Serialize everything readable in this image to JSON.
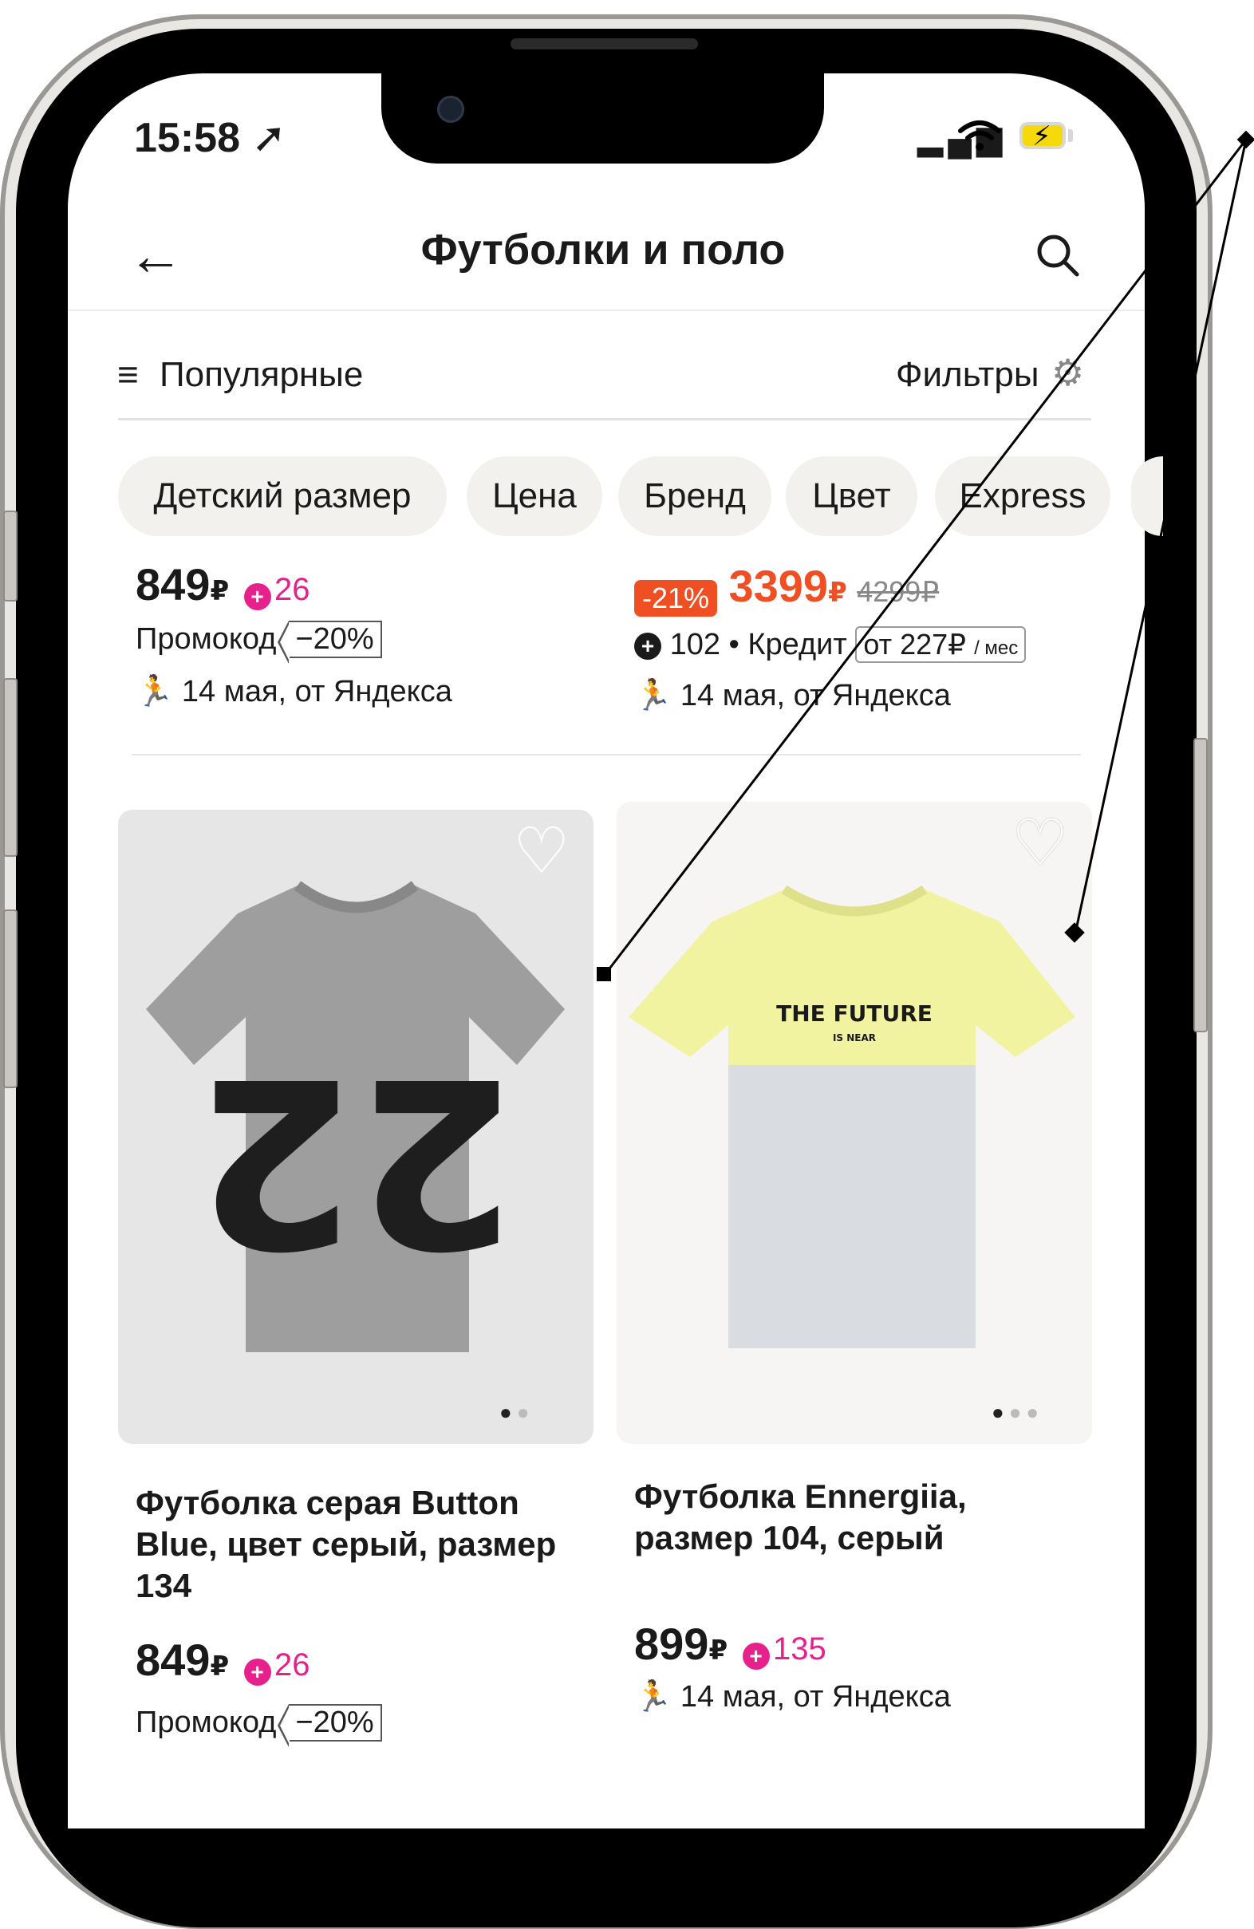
{
  "status_bar": {
    "time": "15:58 ➚",
    "signal": "▂▄▆",
    "wifi": "wifi-icon"
  },
  "header": {
    "back_icon": "←",
    "title": "Футболки и поло",
    "search_icon": "⚲"
  },
  "sort_bar": {
    "sort_icon": "≡",
    "sort_label": "Популярные",
    "filters_label": "Фильтры",
    "filters_icon": "⚙"
  },
  "chips": [
    "Детский размер",
    "Цена",
    "Бренд",
    "Цвет",
    "Express"
  ],
  "top_left": {
    "price": "849",
    "currency": "₽",
    "plus_points": "26",
    "promo_label": "Промокод",
    "promo_value": "−20%",
    "delivery": "14 мая, от Яндекса"
  },
  "top_right": {
    "discount": "-21%",
    "price": "3399",
    "currency": "₽",
    "old_price": "4299₽",
    "plus_points": "102",
    "credit_label": "Кредит",
    "credit_value": "от 227₽",
    "credit_unit": "/ мес",
    "delivery": "14 мая, от Яндекса"
  },
  "products": [
    {
      "title": "Футболка серая Button Blue, цвет серый, размер 134",
      "price": "849",
      "currency": "₽",
      "plus_points": "26",
      "promo_label": "Промокод",
      "promo_value": "−20%",
      "image_print": "22",
      "colors": {
        "bg": "#e6e6e6",
        "shirt": "#9e9e9e"
      }
    },
    {
      "title": "Футболка Ennergiia, размер 104, серый",
      "price": "899",
      "currency": "₽",
      "plus_points": "135",
      "delivery": "14 мая, от Яндекса",
      "image_print": "THE FUTURE",
      "image_print_sub": "IS NEAR",
      "colors": {
        "bg": "#f6f5f3",
        "top": "#f2f3a0",
        "bottom": "#d9dde1"
      }
    }
  ],
  "colors": {
    "plus": "#e7218c",
    "sale": "#f04f23"
  }
}
